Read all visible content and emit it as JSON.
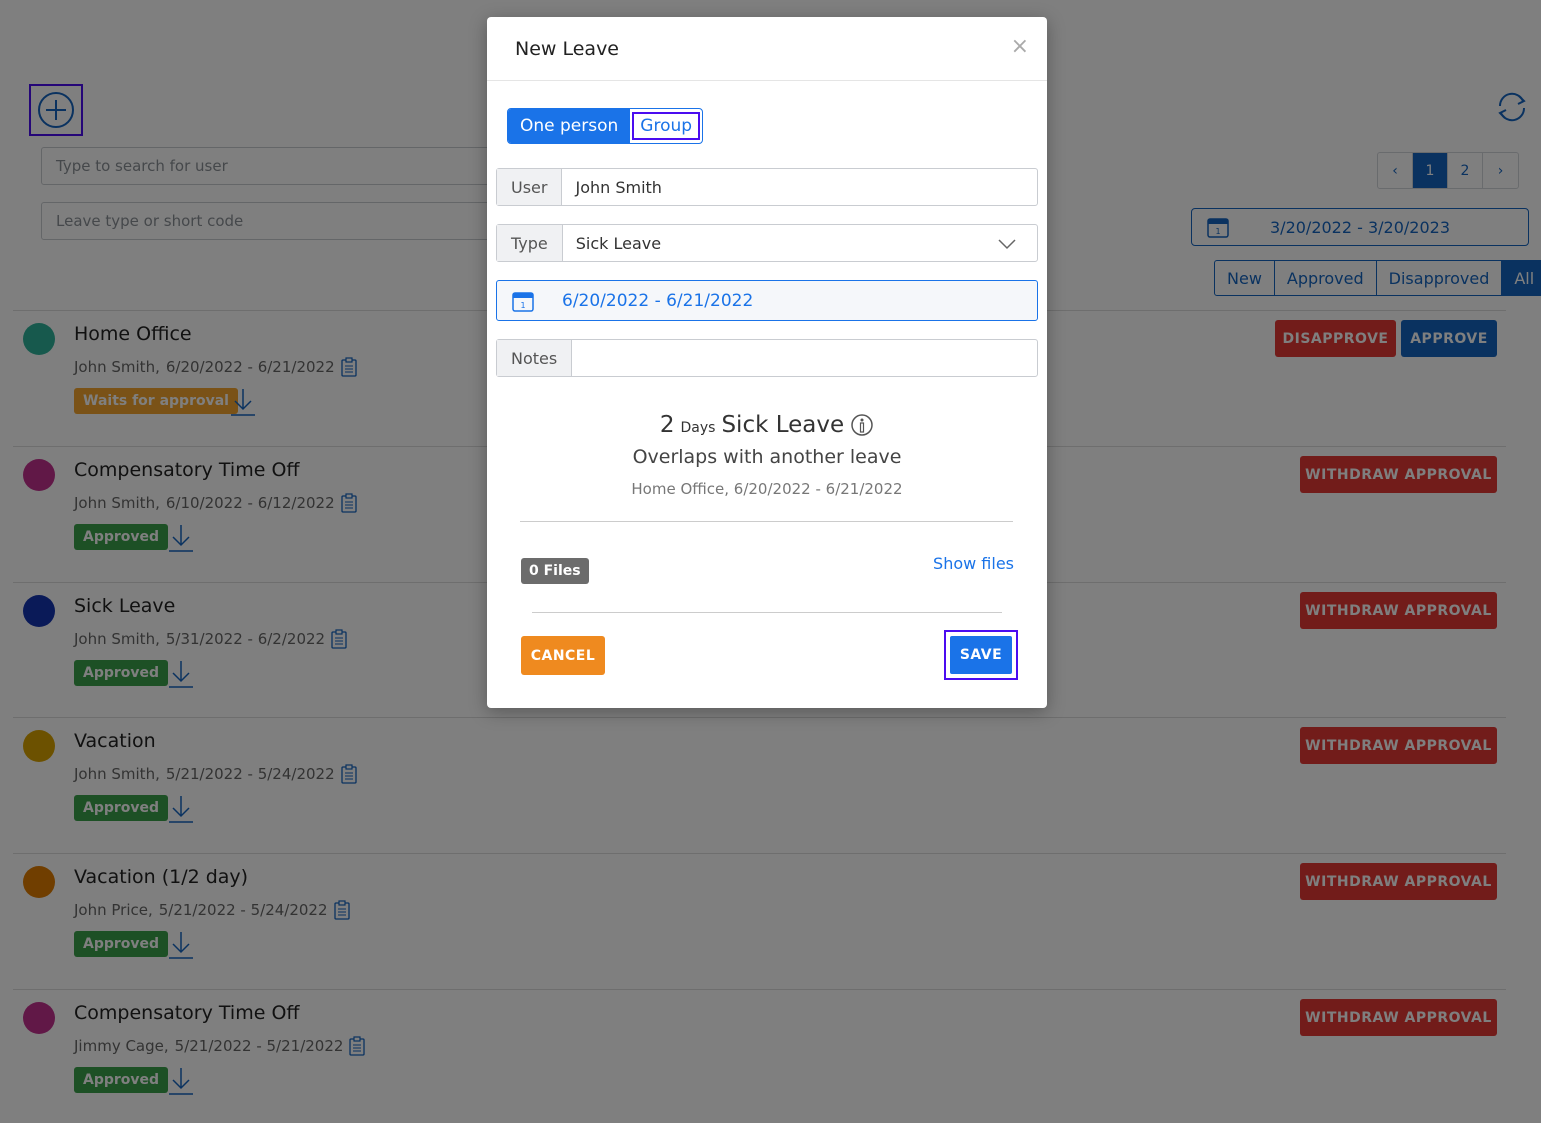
{
  "background": {
    "search_user_placeholder": "Type to search for user",
    "search_type_placeholder": "Leave type or short code",
    "pager": {
      "prev": "‹",
      "pages": [
        "1",
        "2"
      ],
      "next": "›",
      "active": "1"
    },
    "date_range": "3/20/2022 - 3/20/2023",
    "filters": [
      "New",
      "Approved",
      "Disapproved",
      "All"
    ],
    "rows": [
      {
        "title": "Home Office",
        "person": "John Smith,",
        "dates": "6/20/2022 - 6/21/2022",
        "status": "Waits for approval",
        "status_color": "#f4a52e",
        "dot_color": "#2fb39a",
        "actions": [
          "DISAPPROVE",
          "APPROVE"
        ]
      },
      {
        "title": "Compensatory Time Off",
        "person": "John Smith,",
        "dates": "6/10/2022 - 6/12/2022",
        "status": "Approved",
        "status_color": "#3aa04a",
        "dot_color": "#c2318e",
        "actions": [
          "WITHDRAW APPROVAL"
        ]
      },
      {
        "title": "Sick Leave",
        "person": "John Smith,",
        "dates": "5/31/2022 - 6/2/2022",
        "status": "Approved",
        "status_color": "#3aa04a",
        "dot_color": "#1535b0",
        "actions": [
          "WITHDRAW APPROVAL"
        ]
      },
      {
        "title": "Vacation",
        "person": "John Smith,",
        "dates": "5/21/2022 - 5/24/2022",
        "status": "Approved",
        "status_color": "#3aa04a",
        "dot_color": "#d9a300",
        "actions": [
          "WITHDRAW APPROVAL"
        ]
      },
      {
        "title": "Vacation (1/2 day)",
        "person": "John Price,",
        "dates": "5/21/2022 - 5/24/2022",
        "status": "Approved",
        "status_color": "#3aa04a",
        "dot_color": "#e07c00",
        "actions": [
          "WITHDRAW APPROVAL"
        ]
      },
      {
        "title": "Compensatory Time Off",
        "person": "Jimmy Cage,",
        "dates": "5/21/2022 - 5/21/2022",
        "status": "Approved",
        "status_color": "#3aa04a",
        "dot_color": "#c2318e",
        "actions": [
          "WITHDRAW APPROVAL"
        ]
      }
    ]
  },
  "modal": {
    "title": "New Leave",
    "close": "×",
    "mode_one": "One person",
    "mode_group": "Group",
    "user_label": "User",
    "user_value": "John Smith",
    "type_label": "Type",
    "type_value": "Sick Leave",
    "date_value": "6/20/2022 - 6/21/2022",
    "notes_label": "Notes",
    "notes_value": "",
    "summary_count": "2",
    "summary_unit": "Days",
    "summary_type": "Sick Leave",
    "overlap_text": "Overlaps with another leave",
    "overlap_detail": "Home Office,  6/20/2022 - 6/21/2022",
    "files_badge": "0 Files",
    "show_files": "Show files",
    "cancel": "CANCEL",
    "save": "SAVE"
  }
}
